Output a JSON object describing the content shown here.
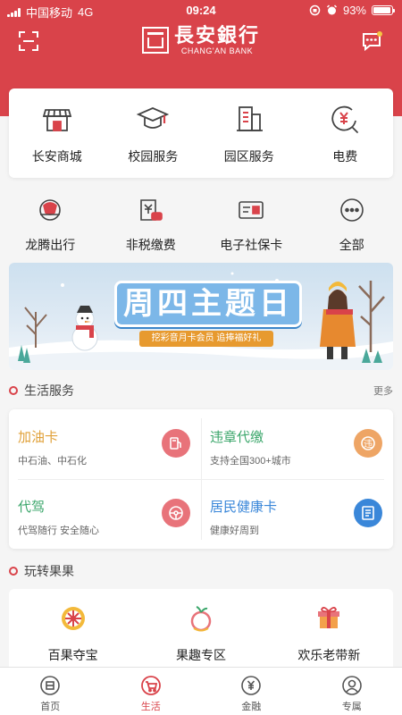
{
  "colors": {
    "brand": "#d9434a",
    "fuel": "#e0a13a",
    "violation": "#3aa66a",
    "driver": "#3aa66a",
    "health": "#3a87d9"
  },
  "status_bar": {
    "carrier": "中国移动",
    "network": "4G",
    "time": "09:24",
    "battery": "93%",
    "battery_level": 0.93
  },
  "header": {
    "logo_cn": "長安銀行",
    "logo_en": "CHANG'AN BANK",
    "left_icon": "scan-icon",
    "right_icon": "message-icon"
  },
  "quick_services": [
    {
      "label": "长安商城",
      "icon": "shop-icon"
    },
    {
      "label": "校园服务",
      "icon": "graduation-cap-icon"
    },
    {
      "label": "园区服务",
      "icon": "building-icon"
    },
    {
      "label": "电费",
      "icon": "yuan-bill-icon"
    }
  ],
  "secondary_services": [
    {
      "label": "龙腾出行",
      "icon": "travel-icon"
    },
    {
      "label": "非税缴费",
      "icon": "tax-payment-icon"
    },
    {
      "label": "电子社保卡",
      "icon": "social-security-card-icon"
    },
    {
      "label": "全部",
      "icon": "more-dots-icon"
    }
  ],
  "banner": {
    "title": "周四主题日",
    "subtitle": "挖彩音月卡会员 追捧福好礼"
  },
  "life_services": {
    "title": "生活服务",
    "more": "更多",
    "items": [
      {
        "name": "加油卡",
        "desc": "中石油、中石化",
        "icon": "fuel-pump-icon"
      },
      {
        "name": "违章代缴",
        "desc": "支持全国300+城市",
        "icon": "violation-icon"
      },
      {
        "name": "代驾",
        "desc": "代驾随行 安全随心",
        "icon": "steering-wheel-icon"
      },
      {
        "name": "居民健康卡",
        "desc": "健康好周到",
        "icon": "health-card-icon"
      }
    ]
  },
  "fruit_section": {
    "title": "玩转果果",
    "items": [
      {
        "label": "百果夺宝",
        "icon": "prize-wheel-icon"
      },
      {
        "label": "果趣专区",
        "icon": "fruit-icon"
      },
      {
        "label": "欢乐老带新",
        "icon": "gift-icon"
      }
    ]
  },
  "tab_bar": [
    {
      "label": "首页",
      "icon": "home-icon",
      "active": false
    },
    {
      "label": "生活",
      "icon": "life-cart-icon",
      "active": true
    },
    {
      "label": "金融",
      "icon": "finance-icon",
      "active": false
    },
    {
      "label": "专属",
      "icon": "profile-icon",
      "active": false
    }
  ]
}
